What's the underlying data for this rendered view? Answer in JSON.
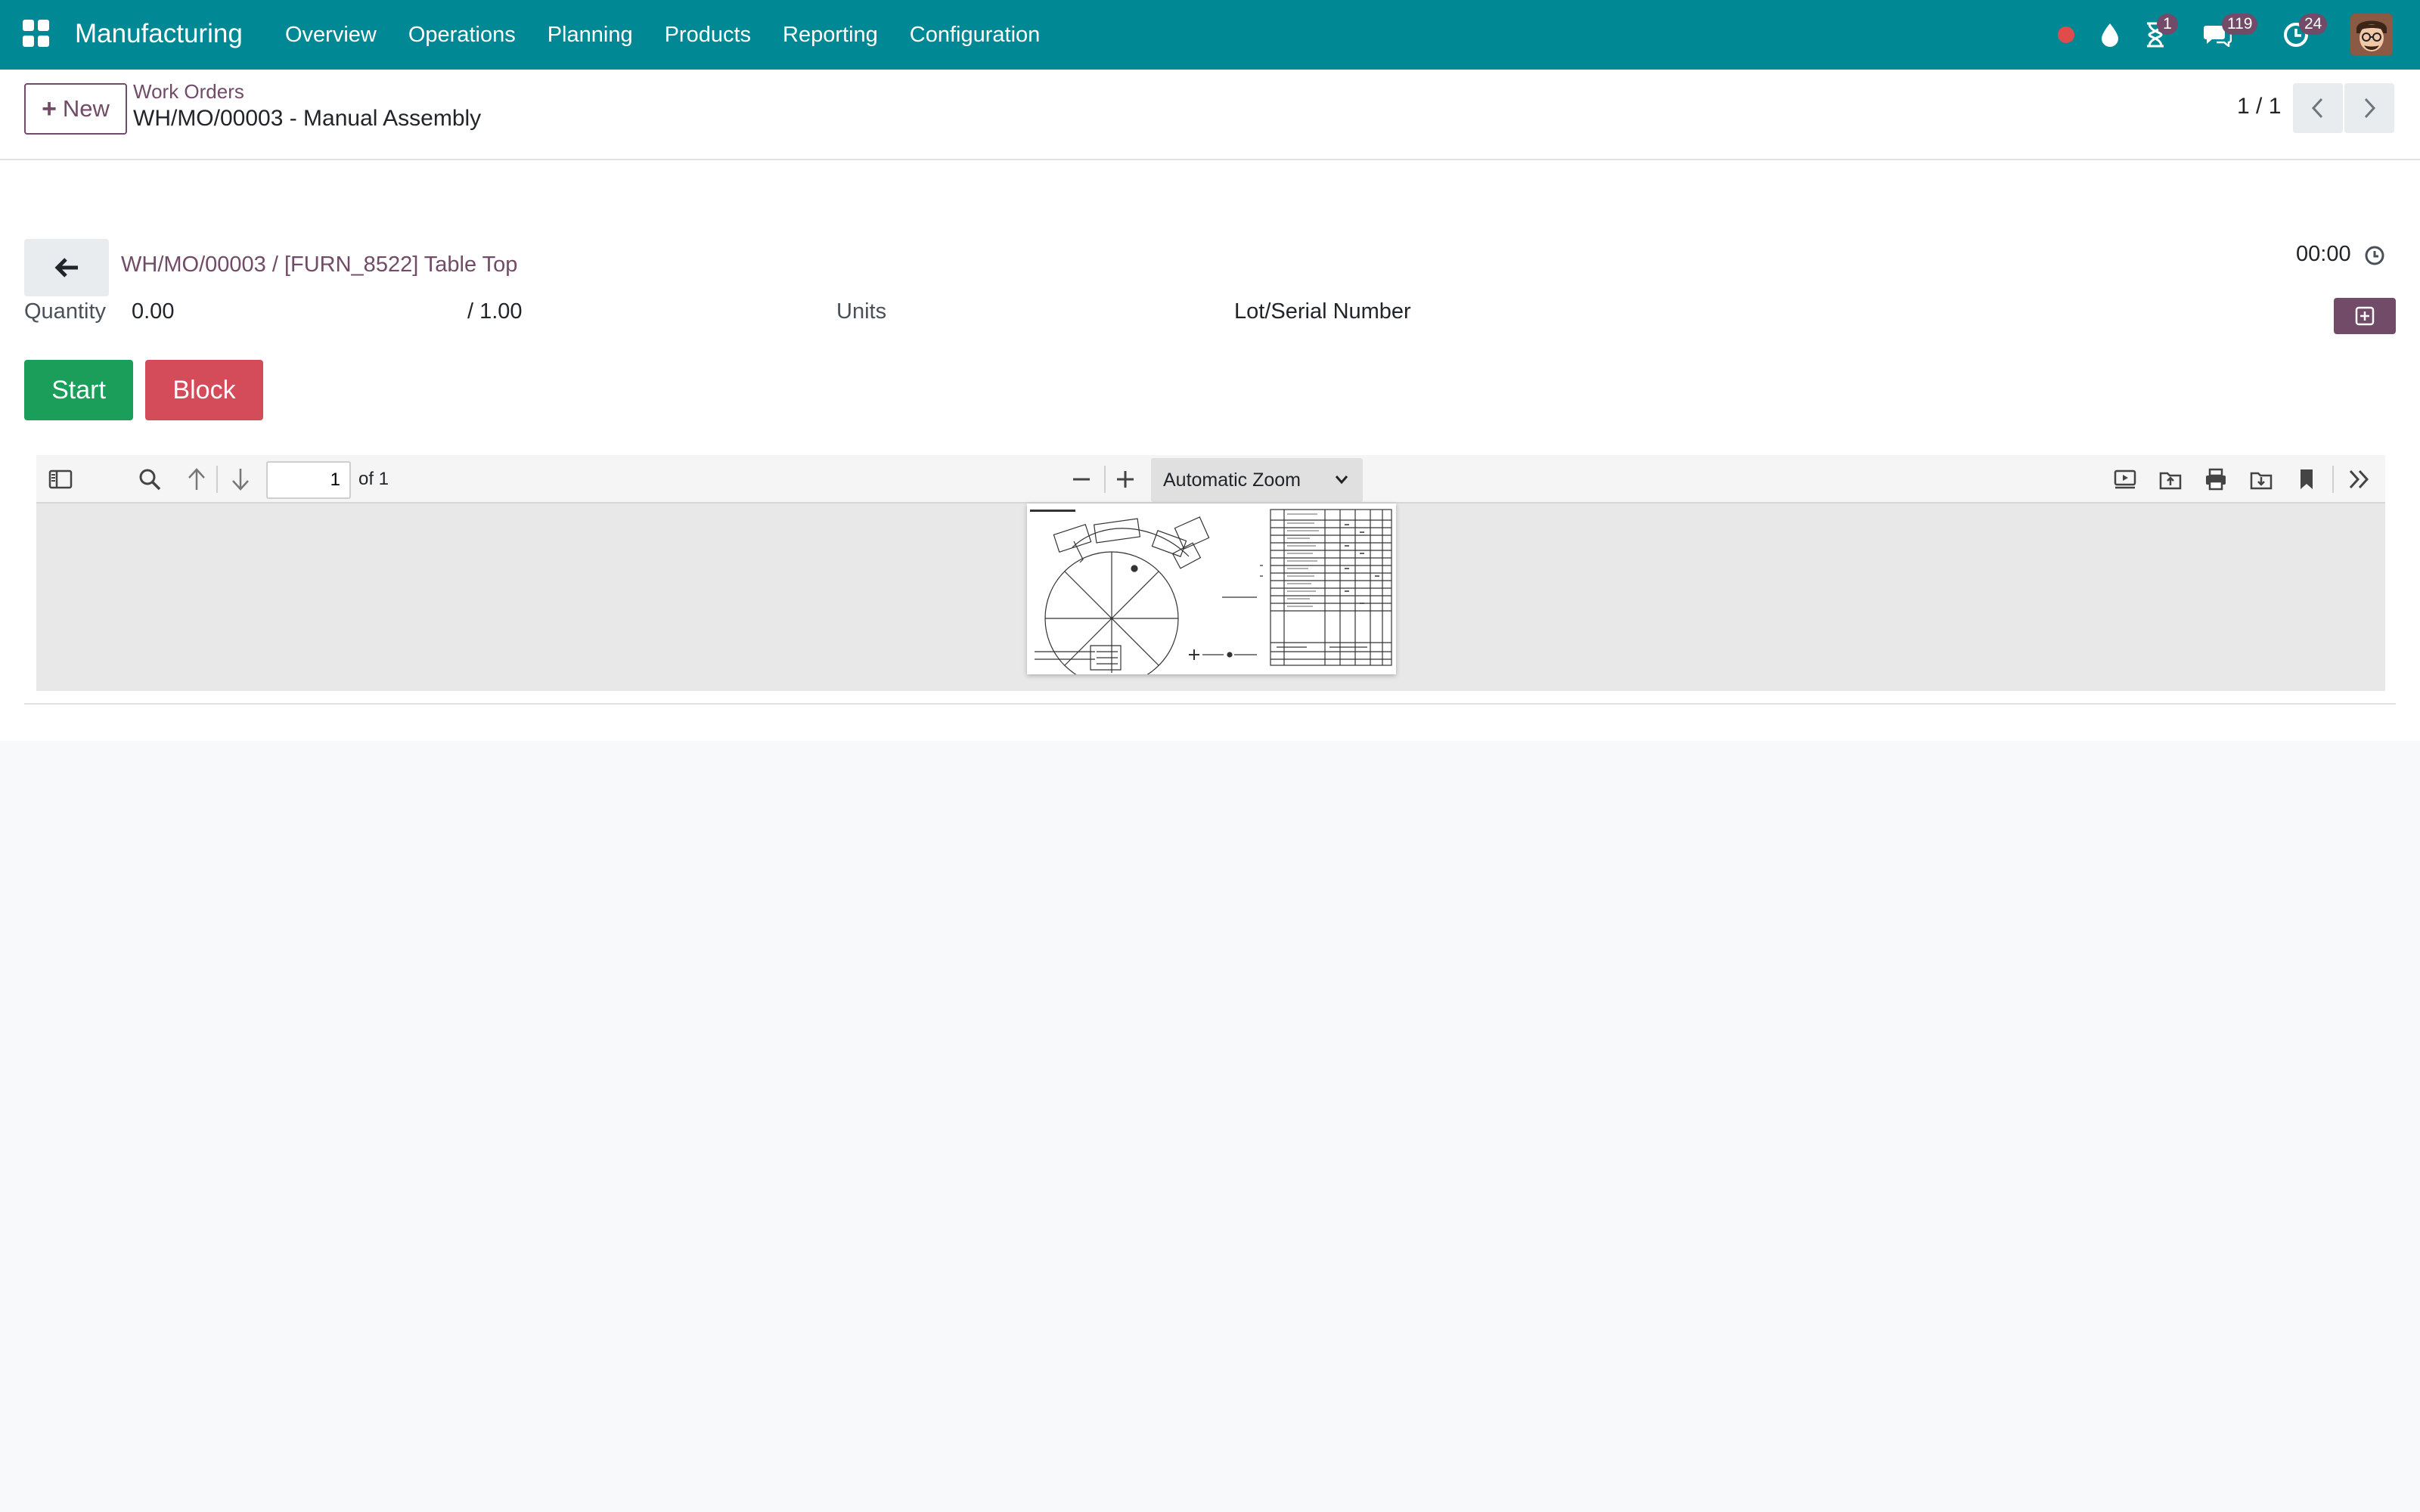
{
  "navbar": {
    "brand": "Manufacturing",
    "menu": [
      "Overview",
      "Operations",
      "Planning",
      "Products",
      "Reporting",
      "Configuration"
    ],
    "badges": {
      "activities": "1",
      "messages": "119",
      "clock": "24"
    },
    "colors": {
      "background": "#018895",
      "badge": "#714b67",
      "recording_dot": "#e04b4b"
    }
  },
  "control_panel": {
    "new_label": "New",
    "breadcrumb_parent": "Work Orders",
    "breadcrumb_current": "WH/MO/00003 - Manual Assembly",
    "pager": "1 / 1"
  },
  "form": {
    "title": "WH/MO/00003 / [FURN_8522] Table Top",
    "timer": "00:00",
    "quantity_label": "Quantity",
    "quantity_value": "0.00",
    "quantity_total": "/ 1.00",
    "uom": "Units",
    "lot_label": "Lot/Serial Number",
    "start_label": "Start",
    "block_label": "Block",
    "colors": {
      "link": "#714b67",
      "start": "#1a9e5a",
      "block": "#d44c59"
    }
  },
  "pdf": {
    "page_number": "1",
    "page_of": "of 1",
    "zoom": "Automatic Zoom"
  }
}
